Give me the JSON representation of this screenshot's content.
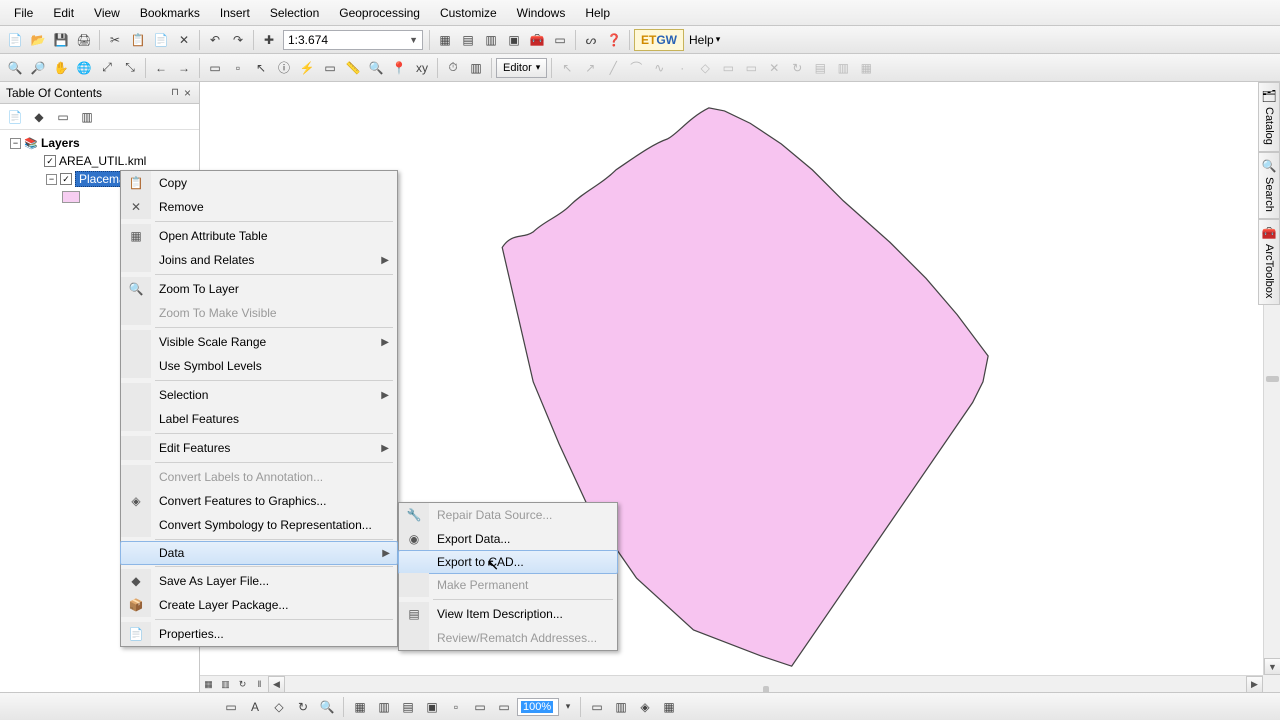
{
  "menubar": [
    "File",
    "Edit",
    "View",
    "Bookmarks",
    "Insert",
    "Selection",
    "Geoprocessing",
    "Customize",
    "Windows",
    "Help"
  ],
  "scale": "1:3.674",
  "editor_label": "Editor",
  "etgw": {
    "et": "ET",
    "gw": "GW"
  },
  "help_label": "Help",
  "toc": {
    "title": "Table Of Contents",
    "layers_label": "Layers",
    "layer1": "AREA_UTIL.kml",
    "layer2": "Placemarks"
  },
  "side_tabs": {
    "catalog": "Catalog",
    "search": "Search",
    "arctoolbox": "ArcToolbox"
  },
  "context_menu": {
    "items": [
      {
        "icon": "📋",
        "label": "Copy"
      },
      {
        "icon": "✕",
        "label": "Remove"
      },
      {
        "sep": true
      },
      {
        "icon": "▦",
        "label": "Open Attribute Table"
      },
      {
        "icon": "",
        "label": "Joins and Relates",
        "submenu": true
      },
      {
        "sep": true
      },
      {
        "icon": "🔍",
        "label": "Zoom To Layer"
      },
      {
        "icon": "",
        "label": "Zoom To Make Visible",
        "disabled": true
      },
      {
        "sep": true
      },
      {
        "icon": "",
        "label": "Visible Scale Range",
        "submenu": true
      },
      {
        "icon": "",
        "label": "Use Symbol Levels"
      },
      {
        "sep": true
      },
      {
        "icon": "",
        "label": "Selection",
        "submenu": true
      },
      {
        "icon": "",
        "label": "Label Features"
      },
      {
        "sep": true
      },
      {
        "icon": "",
        "label": "Edit Features",
        "submenu": true
      },
      {
        "sep": true
      },
      {
        "icon": "",
        "label": "Convert Labels to Annotation...",
        "disabled": true
      },
      {
        "icon": "◈",
        "label": "Convert Features to Graphics..."
      },
      {
        "icon": "",
        "label": "Convert Symbology to Representation..."
      },
      {
        "sep": true
      },
      {
        "icon": "",
        "label": "Data",
        "submenu": true,
        "highlight": true
      },
      {
        "sep": true
      },
      {
        "icon": "◆",
        "label": "Save As Layer File..."
      },
      {
        "icon": "📦",
        "label": "Create Layer Package..."
      },
      {
        "sep": true
      },
      {
        "icon": "📄",
        "label": "Properties..."
      }
    ]
  },
  "submenu": {
    "items": [
      {
        "icon": "🔧",
        "label": "Repair Data Source...",
        "disabled": true
      },
      {
        "icon": "◉",
        "label": "Export Data..."
      },
      {
        "icon": "",
        "label": "Export to CAD...",
        "highlight": true
      },
      {
        "icon": "",
        "label": "Make Permanent",
        "disabled": true
      },
      {
        "sep": true
      },
      {
        "icon": "▤",
        "label": "View Item Description..."
      },
      {
        "icon": "",
        "label": "Review/Rematch Addresses...",
        "disabled": true
      }
    ]
  },
  "bottom": {
    "zoom": "100%"
  }
}
